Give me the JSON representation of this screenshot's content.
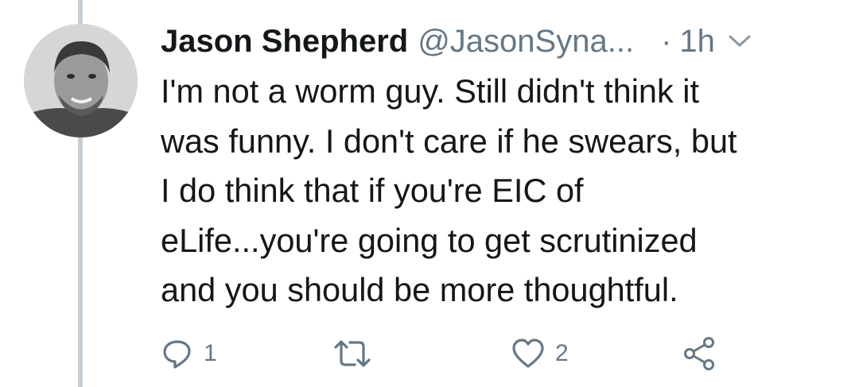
{
  "author": {
    "name": "Jason Shepherd",
    "handle": "@JasonSyna...",
    "separator": "·",
    "time": "1h"
  },
  "tweet": {
    "lines": [
      "I'm not a worm guy. Still didn't think it",
      "was funny. I don't care if he swears, but",
      "I do think that if you're EIC of",
      "eLife...you're going to get scrutinized",
      "and you should be more thoughtful."
    ]
  },
  "actions": {
    "reply_count": "1",
    "retweet_count": "",
    "like_count": "2"
  },
  "icons": {
    "reply": "reply-icon",
    "retweet": "retweet-icon",
    "like": "heart-icon",
    "share": "share-icon",
    "caret": "chevron-down-icon"
  },
  "colors": {
    "text": "#14171a",
    "secondary": "#657786",
    "thread_line": "#c4ced6"
  }
}
